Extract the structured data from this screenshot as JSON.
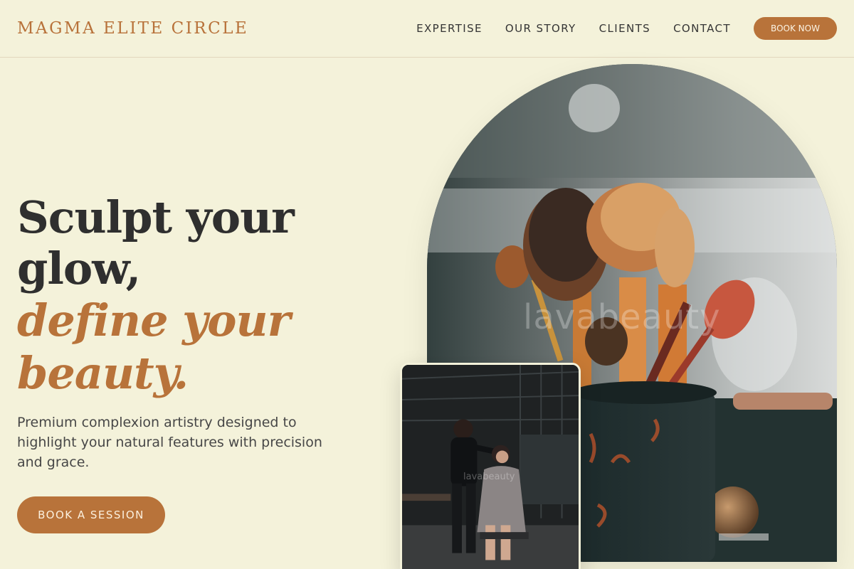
{
  "header": {
    "brand": "MAGMA ELITE CIRCLE",
    "nav": [
      "EXPERTISE",
      "OUR STORY",
      "CLIENTS",
      "CONTACT"
    ],
    "book_now": "BOOK NOW"
  },
  "hero": {
    "headline_line1": "Sculpt your glow,",
    "headline_line2": "define your beauty.",
    "lead": "Premium complexion artistry designed to highlight your natural features with precision and grace.",
    "cta": "BOOK A SESSION"
  },
  "images": {
    "main_watermark": "lavabeauty",
    "card_watermark": "lavabeauty"
  },
  "colors": {
    "background": "#f4f2da",
    "accent": "#b8733a",
    "text": "#2f2f2f"
  }
}
